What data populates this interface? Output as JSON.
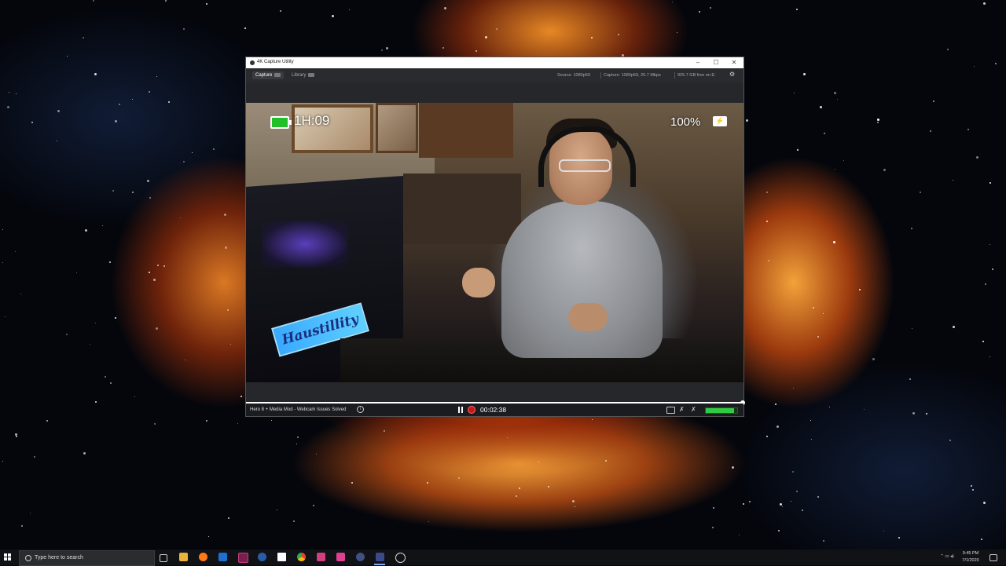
{
  "window": {
    "title": "4K Capture Utility",
    "minimize": "–",
    "maximize": "☐",
    "close": "✕"
  },
  "nav": {
    "tabs": [
      {
        "label": "Capture",
        "active": true
      },
      {
        "label": "Library",
        "active": false
      }
    ],
    "source": "Source: 1080p59",
    "capture": "Capture: 1080p59, 26.7 Mbps",
    "free_space": "925.7 GB free on E:",
    "settings_icon": "gear-icon"
  },
  "overlay": {
    "battery_time": "1H:09",
    "battery_color": "#21c02a",
    "percent": "100%",
    "power_icon": "plug-icon"
  },
  "video_text": {
    "logo": "Haustillity"
  },
  "status": {
    "title": "Hero 8 + Media Mod - Webcam Issues Solved",
    "recording_time": "00:02:38",
    "progress": 1.0,
    "audio_level": 0.9
  },
  "taskbar": {
    "search_placeholder": "Type here to search",
    "time": "9:45 PM",
    "date": "7/1/2020",
    "apps": [
      "task-view",
      "file-explorer",
      "firefox",
      "photoshop",
      "visual-studio",
      "steam",
      "obs",
      "chrome",
      "epic-games",
      "app-pink",
      "app-blue",
      "capture-utility",
      "app-globe"
    ]
  },
  "colors": {
    "accent_record": "#c8161d",
    "audio_meter": "#2ecc40"
  }
}
